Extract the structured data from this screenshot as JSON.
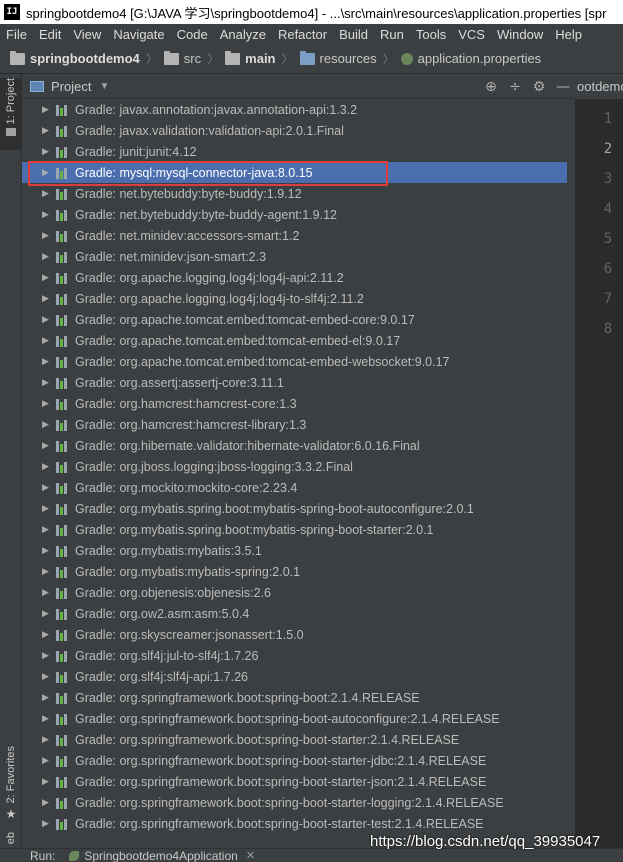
{
  "window": {
    "app_icon": "IJ",
    "title": "springbootdemo4 [G:\\JAVA 学习\\springbootdemo4] - ...\\src\\main\\resources\\application.properties [spr"
  },
  "menu": [
    "File",
    "Edit",
    "View",
    "Navigate",
    "Code",
    "Analyze",
    "Refactor",
    "Build",
    "Run",
    "Tools",
    "VCS",
    "Window",
    "Help"
  ],
  "breadcrumb": {
    "items": [
      {
        "label": "springbootdemo4",
        "icon": "folder-icon",
        "bold": true
      },
      {
        "label": "src",
        "icon": "folder-icon",
        "bold": false
      },
      {
        "label": "main",
        "icon": "folder-icon",
        "bold": true
      },
      {
        "label": "resources",
        "icon": "resources-folder-icon",
        "bold": false
      },
      {
        "label": "application.properties",
        "icon": "spring-properties-icon",
        "bold": false
      }
    ]
  },
  "left_strip": {
    "project_tab": "1: Project",
    "favorites_tab": "2: Favorites",
    "web_tab": "eb"
  },
  "panel": {
    "title": "Project",
    "tools": [
      "globe-icon",
      "collapse-icon",
      "gear-icon",
      "hide-icon"
    ]
  },
  "tree": {
    "selected_index": 3,
    "items": [
      "Gradle: javax.annotation:javax.annotation-api:1.3.2",
      "Gradle: javax.validation:validation-api:2.0.1.Final",
      "Gradle: junit:junit:4.12",
      "Gradle: mysql:mysql-connector-java:8.0.15",
      "Gradle: net.bytebuddy:byte-buddy:1.9.12",
      "Gradle: net.bytebuddy:byte-buddy-agent:1.9.12",
      "Gradle: net.minidev:accessors-smart:1.2",
      "Gradle: net.minidev:json-smart:2.3",
      "Gradle: org.apache.logging.log4j:log4j-api:2.11.2",
      "Gradle: org.apache.logging.log4j:log4j-to-slf4j:2.11.2",
      "Gradle: org.apache.tomcat.embed:tomcat-embed-core:9.0.17",
      "Gradle: org.apache.tomcat.embed:tomcat-embed-el:9.0.17",
      "Gradle: org.apache.tomcat.embed:tomcat-embed-websocket:9.0.17",
      "Gradle: org.assertj:assertj-core:3.11.1",
      "Gradle: org.hamcrest:hamcrest-core:1.3",
      "Gradle: org.hamcrest:hamcrest-library:1.3",
      "Gradle: org.hibernate.validator:hibernate-validator:6.0.16.Final",
      "Gradle: org.jboss.logging:jboss-logging:3.3.2.Final",
      "Gradle: org.mockito:mockito-core:2.23.4",
      "Gradle: org.mybatis.spring.boot:mybatis-spring-boot-autoconfigure:2.0.1",
      "Gradle: org.mybatis.spring.boot:mybatis-spring-boot-starter:2.0.1",
      "Gradle: org.mybatis:mybatis:3.5.1",
      "Gradle: org.mybatis:mybatis-spring:2.0.1",
      "Gradle: org.objenesis:objenesis:2.6",
      "Gradle: org.ow2.asm:asm:5.0.4",
      "Gradle: org.skyscreamer:jsonassert:1.5.0",
      "Gradle: org.slf4j:jul-to-slf4j:1.7.26",
      "Gradle: org.slf4j:slf4j-api:1.7.26",
      "Gradle: org.springframework.boot:spring-boot:2.1.4.RELEASE",
      "Gradle: org.springframework.boot:spring-boot-autoconfigure:2.1.4.RELEASE",
      "Gradle: org.springframework.boot:spring-boot-starter:2.1.4.RELEASE",
      "Gradle: org.springframework.boot:spring-boot-starter-jdbc:2.1.4.RELEASE",
      "Gradle: org.springframework.boot:spring-boot-starter-json:2.1.4.RELEASE",
      "Gradle: org.springframework.boot:spring-boot-starter-logging:2.1.4.RELEASE",
      "Gradle: org.springframework.boot:spring-boot-starter-test:2.1.4.RELEASE"
    ]
  },
  "editor": {
    "tab_label": "ootdemo",
    "line_numbers": [
      "1",
      "2",
      "3",
      "4",
      "5",
      "6",
      "7",
      "8"
    ],
    "current_line": "2"
  },
  "bottom": {
    "run_label": "Run:",
    "run_config": "Springbootdemo4Application"
  },
  "watermark": "https://blog.csdn.net/qq_39935047",
  "colors": {
    "selection": "#4b6eaf",
    "highlight_box": "#e03c3c",
    "panel_bg": "#3c3f41",
    "editor_bg": "#2b2b2b"
  }
}
